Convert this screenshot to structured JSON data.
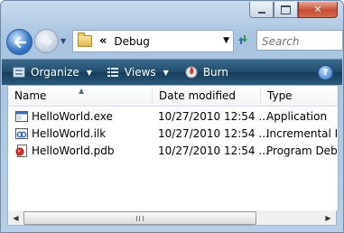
{
  "window": {
    "minimize_icon": "minimize-icon",
    "maximize_icon": "maximize-icon",
    "close_icon": "close-icon",
    "close_glyph": "✕"
  },
  "navigation": {
    "address_chevron": "«",
    "address_path": "Debug",
    "search_placeholder": "Search"
  },
  "toolbar": {
    "organize_label": "Organize",
    "views_label": "Views",
    "burn_label": "Burn",
    "help_glyph": "?"
  },
  "file_list": {
    "columns": [
      "Name",
      "Date modified",
      "Type"
    ],
    "rows": [
      {
        "name": "HelloWorld.exe",
        "date": "10/27/2010 12:54 ...",
        "type": "Application",
        "icon": "application-file-icon"
      },
      {
        "name": "HelloWorld.ilk",
        "date": "10/27/2010 12:54 ...",
        "type": "Incremental Lin",
        "icon": "incremental-link-file-icon"
      },
      {
        "name": "HelloWorld.pdb",
        "date": "10/27/2010 12:54 ...",
        "type": "Program Debug",
        "icon": "program-debug-file-icon"
      }
    ]
  },
  "colors": {
    "toolbar_bg": "#1f4b6c",
    "window_frame": "#b7cee6",
    "close_button": "#c84b31"
  }
}
